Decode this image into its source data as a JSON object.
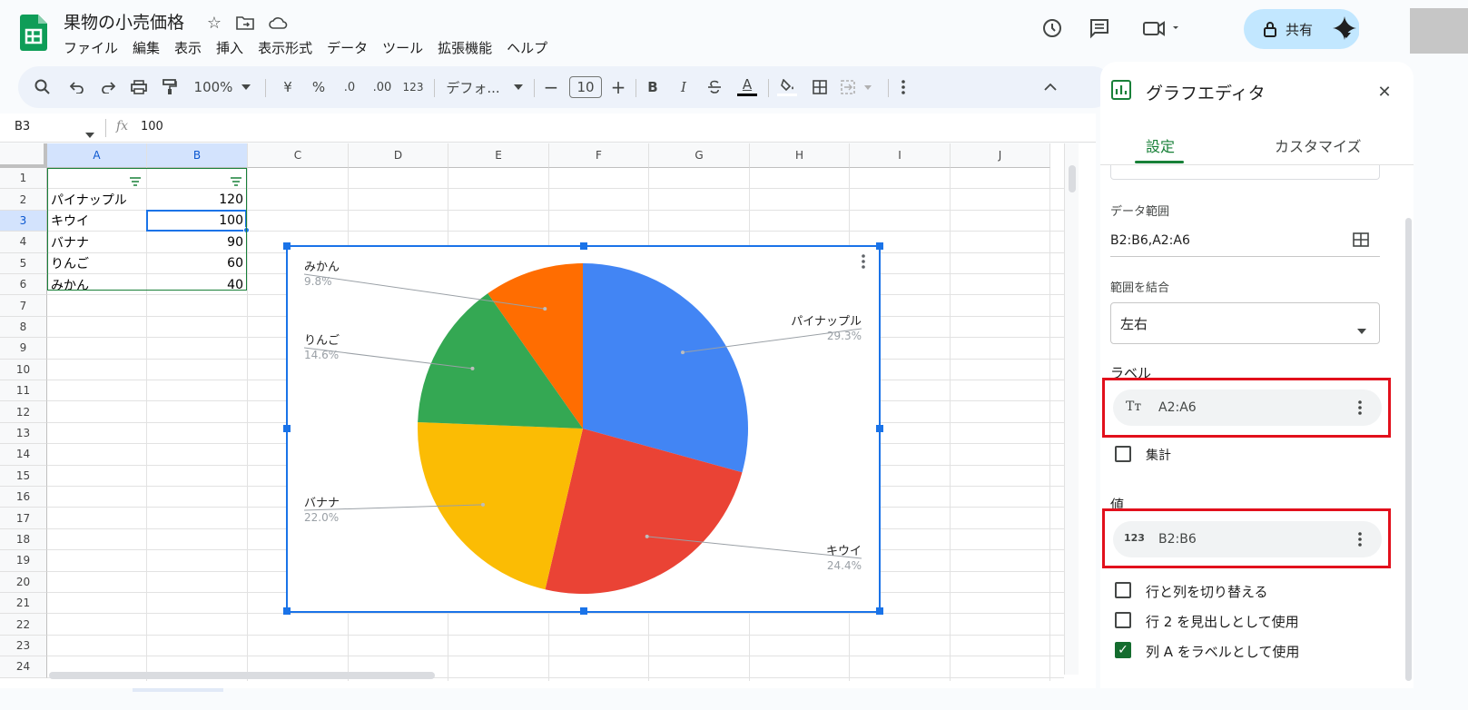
{
  "app": {
    "title": "果物の小売価格"
  },
  "menu": [
    "ファイル",
    "編集",
    "表示",
    "挿入",
    "表示形式",
    "データ",
    "ツール",
    "拡張機能",
    "ヘルプ"
  ],
  "header": {
    "share_label": "共有"
  },
  "toolbar": {
    "zoom": "100%",
    "currency": "¥",
    "percent": "%",
    "dec_less": ".0",
    "dec_more": ".00",
    "number_format": "123",
    "font": "デフォ...",
    "font_size": "10",
    "bold": "B",
    "italic": "I",
    "text_color": "A"
  },
  "formula_bar": {
    "cell_ref": "B3",
    "fx": "fx",
    "value": "100"
  },
  "sheet": {
    "columns": [
      "A",
      "B",
      "C",
      "D",
      "E",
      "F",
      "G",
      "H",
      "I",
      "J"
    ],
    "rows": [
      "1",
      "2",
      "3",
      "4",
      "5",
      "6",
      "7",
      "8",
      "9",
      "10",
      "11",
      "12",
      "13",
      "14",
      "15",
      "16",
      "17",
      "18",
      "19",
      "20",
      "21",
      "22",
      "23",
      "24"
    ],
    "data": [
      {
        "name": "パイナップル",
        "value": "120"
      },
      {
        "name": "キウイ",
        "value": "100"
      },
      {
        "name": "バナナ",
        "value": "90"
      },
      {
        "name": "りんご",
        "value": "60"
      },
      {
        "name": "みかん",
        "value": "40"
      }
    ]
  },
  "chart_data": {
    "type": "pie",
    "categories": [
      "パイナップル",
      "キウイ",
      "バナナ",
      "りんご",
      "みかん"
    ],
    "values": [
      120,
      100,
      90,
      60,
      40
    ],
    "percent_labels": [
      "29.3%",
      "24.4%",
      "22.0%",
      "14.6%",
      "9.8%"
    ],
    "colors": [
      "#4285f4",
      "#ea4335",
      "#fbbc04",
      "#34a853",
      "#ff6d01"
    ]
  },
  "editor": {
    "title": "グラフエディタ",
    "tabs": [
      "設定",
      "カスタマイズ"
    ],
    "data_range_label": "データ範囲",
    "data_range_value": "B2:B6,A2:A6",
    "combine_label": "範囲を結合",
    "combine_value": "左右",
    "label_section": "ラベル",
    "label_chip": "A2:A6",
    "aggregate_label": "集計",
    "value_section": "値",
    "value_chip": "B2:B6",
    "checkboxes": [
      {
        "label": "行と列を切り替える",
        "checked": false
      },
      {
        "label": "行 2 を見出しとして使用",
        "checked": false
      },
      {
        "label": "列 A をラベルとして使用",
        "checked": true
      }
    ]
  }
}
